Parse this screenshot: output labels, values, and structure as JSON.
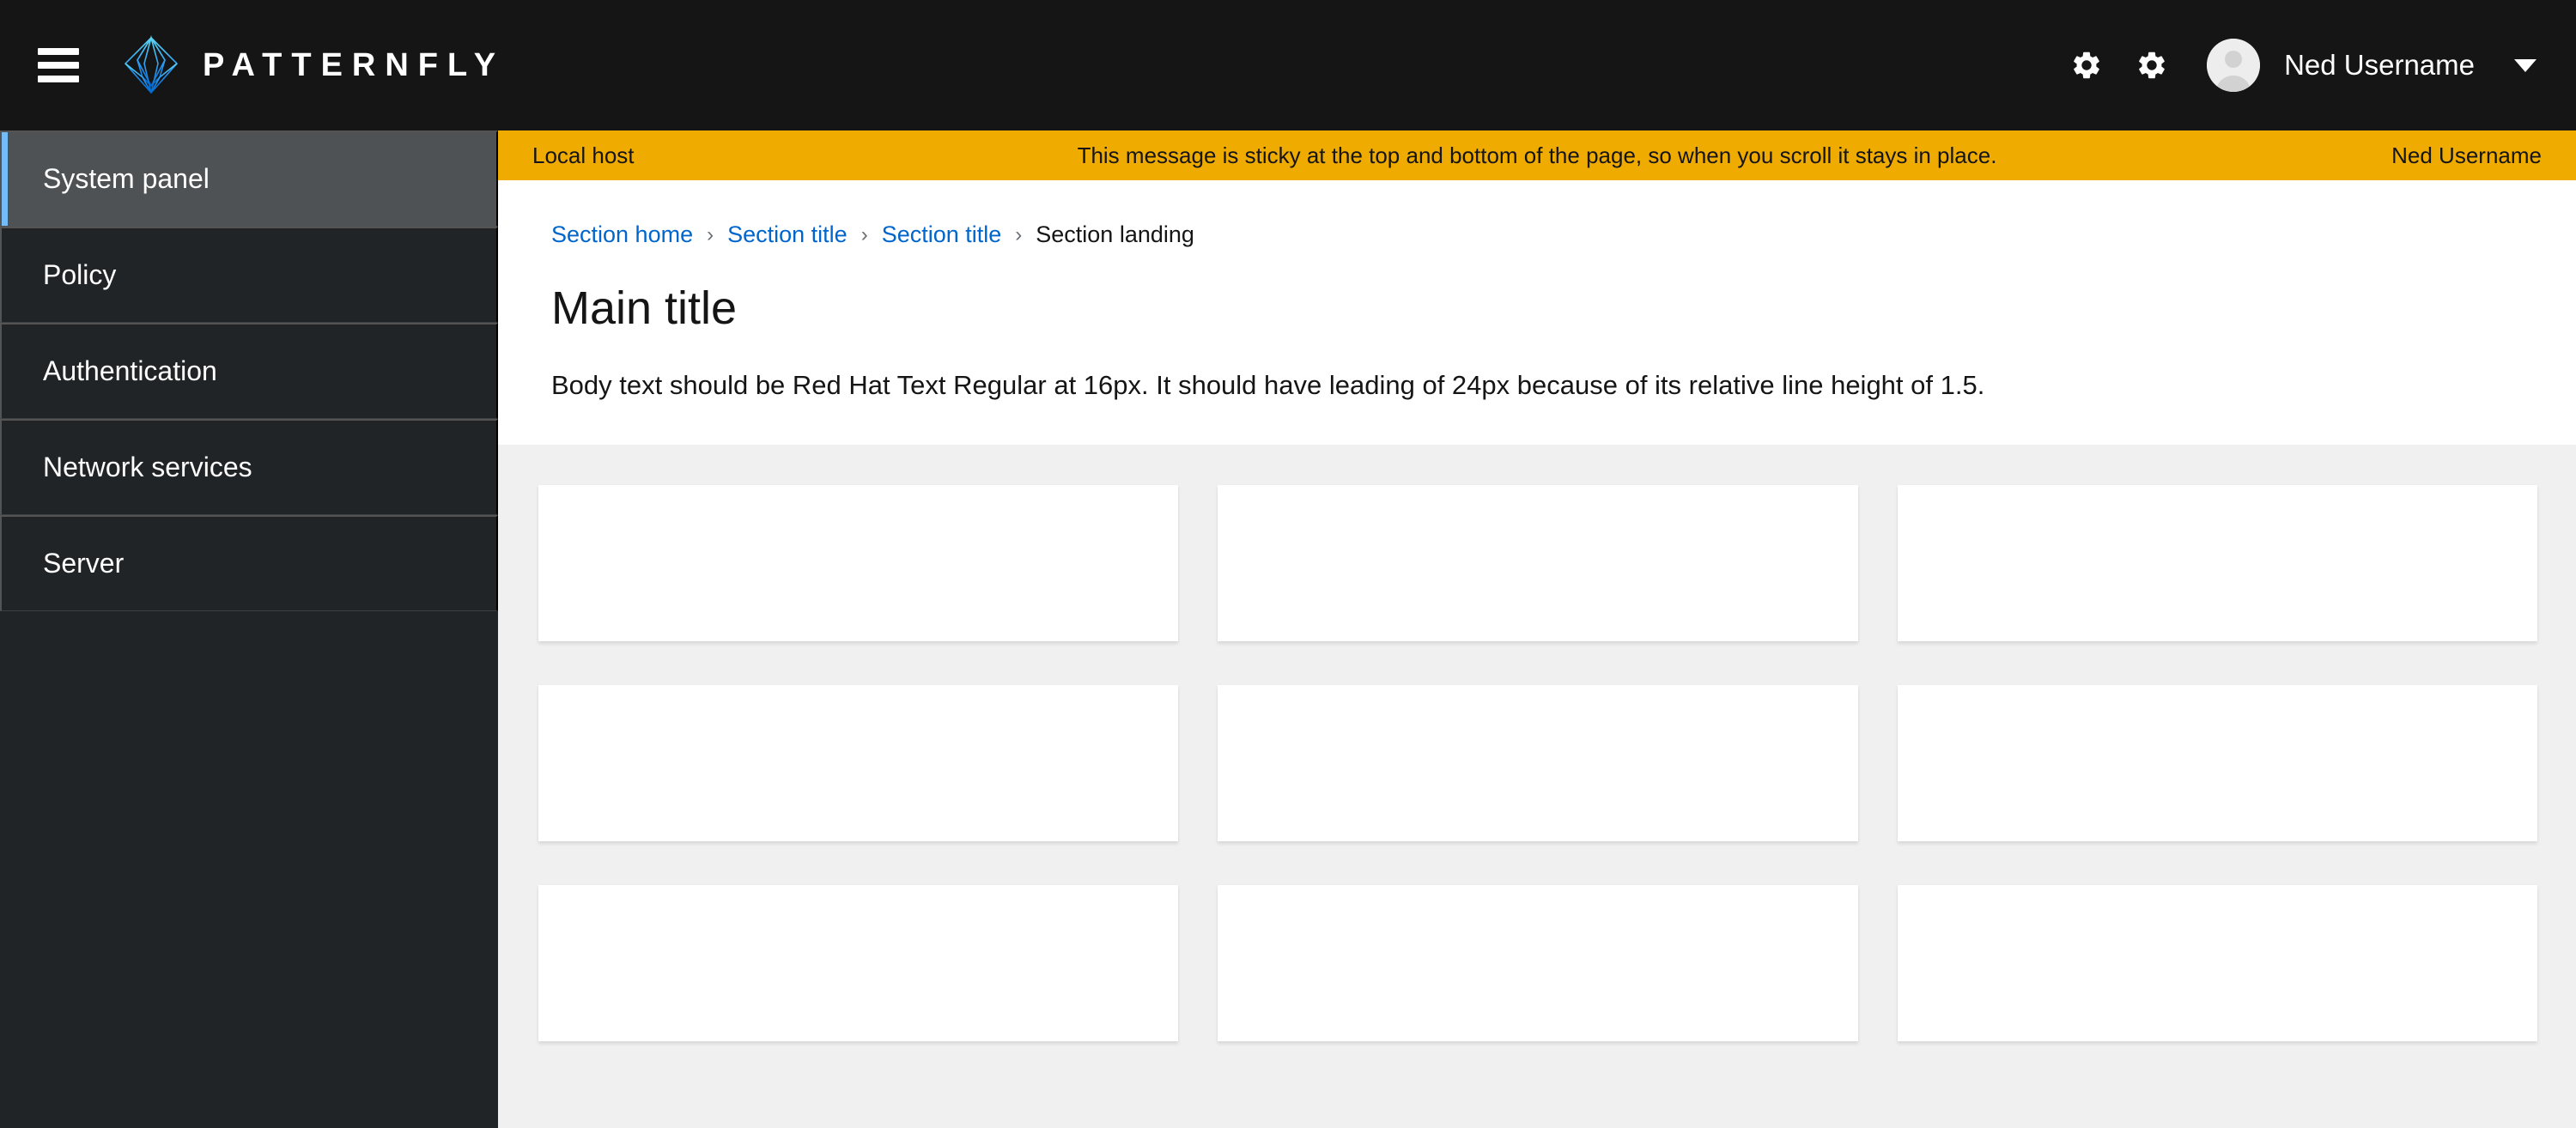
{
  "masthead": {
    "toggle_label": "Global navigation toggle",
    "brand_name": "PATTERNFLY",
    "logo_icon": "patternfly-logo-icon",
    "actions": [
      {
        "icon": "gear-icon",
        "label": "Settings"
      },
      {
        "icon": "gear-icon",
        "label": "Settings"
      }
    ],
    "user": {
      "name": "Ned Username",
      "avatar_icon": "avatar-icon",
      "caret_icon": "chevron-down-icon"
    }
  },
  "sidebar": {
    "items": [
      {
        "label": "System panel",
        "active": true
      },
      {
        "label": "Policy",
        "active": false
      },
      {
        "label": "Authentication",
        "active": false
      },
      {
        "label": "Network services",
        "active": false
      },
      {
        "label": "Server",
        "active": false
      }
    ]
  },
  "banner": {
    "left": "Local host",
    "center": "This message is sticky at the top and bottom of the page, so when you scroll it stays in place.",
    "right": "Ned Username"
  },
  "breadcrumb": {
    "separator": "›",
    "items": [
      {
        "label": "Section home",
        "current": false
      },
      {
        "label": "Section title",
        "current": false
      },
      {
        "label": "Section title",
        "current": false
      },
      {
        "label": "Section landing",
        "current": true
      }
    ]
  },
  "page": {
    "title": "Main title",
    "body": "Body text should be Red Hat Text Regular at 16px. It should have leading of 24px because of its relative line height of 1.5."
  },
  "cards": {
    "count": 9,
    "columns": 3,
    "items": [
      {
        "content": ""
      },
      {
        "content": ""
      },
      {
        "content": ""
      },
      {
        "content": ""
      },
      {
        "content": ""
      },
      {
        "content": ""
      },
      {
        "content": ""
      },
      {
        "content": ""
      },
      {
        "content": ""
      }
    ]
  },
  "colors": {
    "masthead_bg": "#151515",
    "sidebar_bg": "#212427",
    "sidebar_active_bg": "#4f5255",
    "sidebar_accent": "#73bcf7",
    "banner_bg": "#f0ab00",
    "link": "#0066cc",
    "content_bg": "#f0f0f0",
    "card_bg": "#ffffff",
    "brand_cyan": "#2b9af3"
  }
}
